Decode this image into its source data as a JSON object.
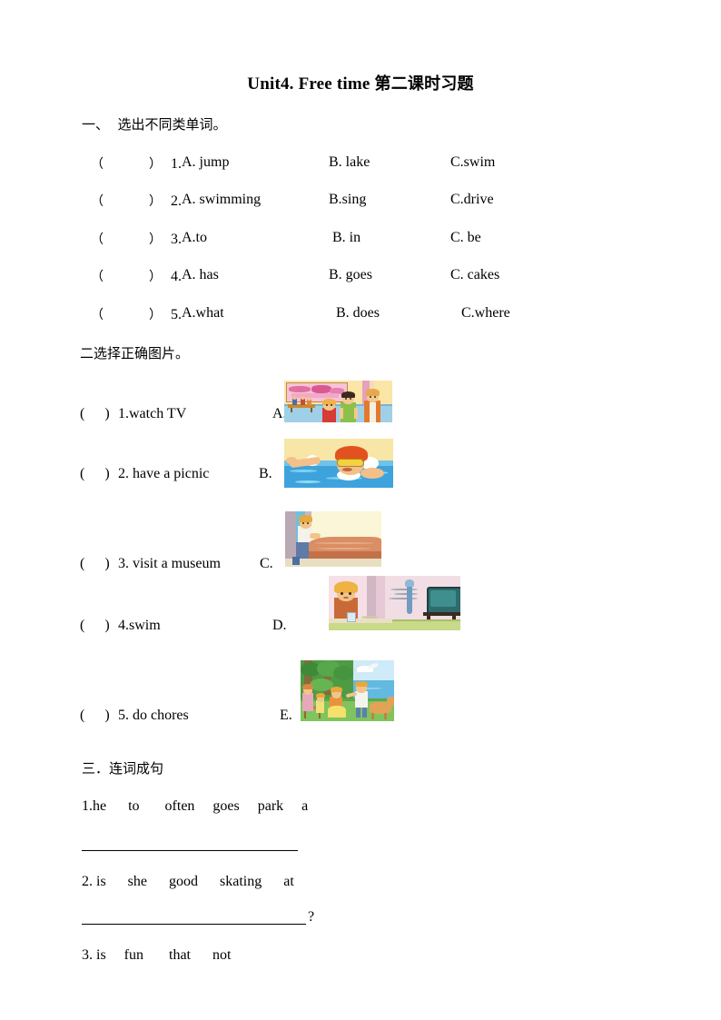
{
  "document": {
    "title_en": "Unit4. Free time ",
    "title_cn": "第二课时习题"
  },
  "section1": {
    "heading": "一、  选出不同类单词。",
    "paren_open": "（",
    "paren_close": "）",
    "items": [
      {
        "num": "1.",
        "a": "A. jump",
        "b": "B. lake",
        "c": "C.swim"
      },
      {
        "num": "2.",
        "a": "A. swimming",
        "b": "B.sing",
        "c": "C.drive"
      },
      {
        "num": "3.",
        "a": "A.to",
        "b": "B. in",
        "c": "C. be"
      },
      {
        "num": "4.",
        "a": "A. has",
        "b": "B. goes",
        "c": "C. cakes"
      },
      {
        "num": "5.",
        "a": "A.what",
        "b": "B. does",
        "c": "C.where"
      }
    ]
  },
  "section2": {
    "heading": "二选择正确图片。",
    "paren_open": "(",
    "paren_close": ")",
    "items": [
      {
        "num": "1.",
        "phrase": "watch TV",
        "label": "A.",
        "picture": "museum-visit-picture"
      },
      {
        "num": "2.",
        "phrase": " have a picnic",
        "label": "B.",
        "picture": "swimming-picture"
      },
      {
        "num": "3.",
        "phrase": " visit  a museum",
        "label": "C.",
        "picture": "making-bed-picture"
      },
      {
        "num": "4.",
        "phrase": "swim",
        "label": "D.",
        "picture": "watching-tv-picture"
      },
      {
        "num": "5.",
        "phrase": " do chores",
        "label": "E.",
        "picture": "picnic-picture"
      }
    ]
  },
  "section3": {
    "heading": "三．连词成句",
    "items": [
      {
        "text": "1.he      to       often     goes     park     a",
        "answer_mark": ""
      },
      {
        "text": "2. is      she      good      skating      at",
        "answer_mark": "?"
      },
      {
        "text": "3. is     fun       that      not",
        "answer_mark": ""
      }
    ]
  },
  "colors": {
    "text": "#000000",
    "page": "#ffffff",
    "rule": "#000000"
  }
}
